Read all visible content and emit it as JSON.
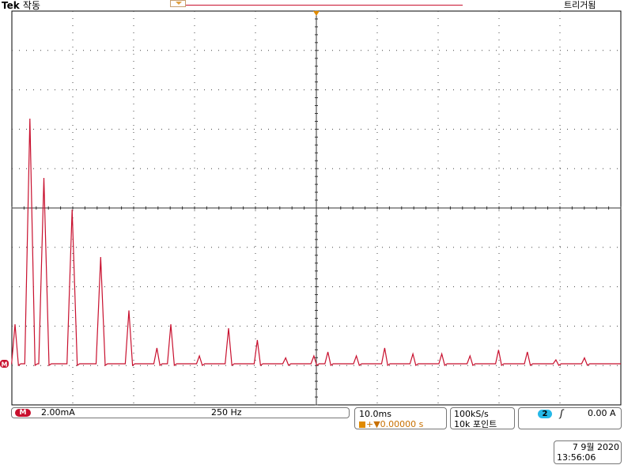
{
  "header": {
    "brand": "Tek",
    "run_state": "작동",
    "trigger_status": "트리거됨"
  },
  "channel": {
    "badge": "M",
    "scale": "2.00mA",
    "bandwidth": "250 Hz",
    "marker_label": "M",
    "color": "#c8102e"
  },
  "timebase": {
    "scale": "10.0ms",
    "position": "+▼0.00000 s"
  },
  "acquisition": {
    "sample_rate": "100kS/s",
    "record_length": "10k 포인트"
  },
  "trigger": {
    "source": "2",
    "slope_icon": "rising-edge-icon",
    "level": "0.00 A",
    "source_color": "#25b8e8"
  },
  "datetime": {
    "date": "7 9월  2020",
    "time": "13:56:06"
  },
  "chart_data": {
    "type": "line",
    "title": "",
    "xlabel": "",
    "ylabel": "",
    "grid": true,
    "x_divisions": 10,
    "y_divisions": 5,
    "baseline_div": 0,
    "xlim": [
      0,
      10
    ],
    "ylim": [
      -1,
      9
    ],
    "x": [
      0.0,
      0.5,
      0.97,
      1.92,
      2.88,
      3.83,
      4.77,
      5.24,
      6.2,
      7.18,
      8.15,
      9.1,
      10.05,
      10.52,
      11.48,
      12.43,
      13.38,
      14.35,
      15.3,
      16.26,
      17.23,
      18.19,
      19.15
    ],
    "y": [
      1.0,
      6.2,
      4.7,
      3.9,
      2.7,
      1.35,
      0.4,
      1.0,
      0.2,
      0.9,
      0.6,
      0.15,
      0.2,
      0.3,
      0.2,
      0.4,
      0.25,
      0.25,
      0.2,
      0.35,
      0.3,
      0.1,
      0.15
    ]
  }
}
